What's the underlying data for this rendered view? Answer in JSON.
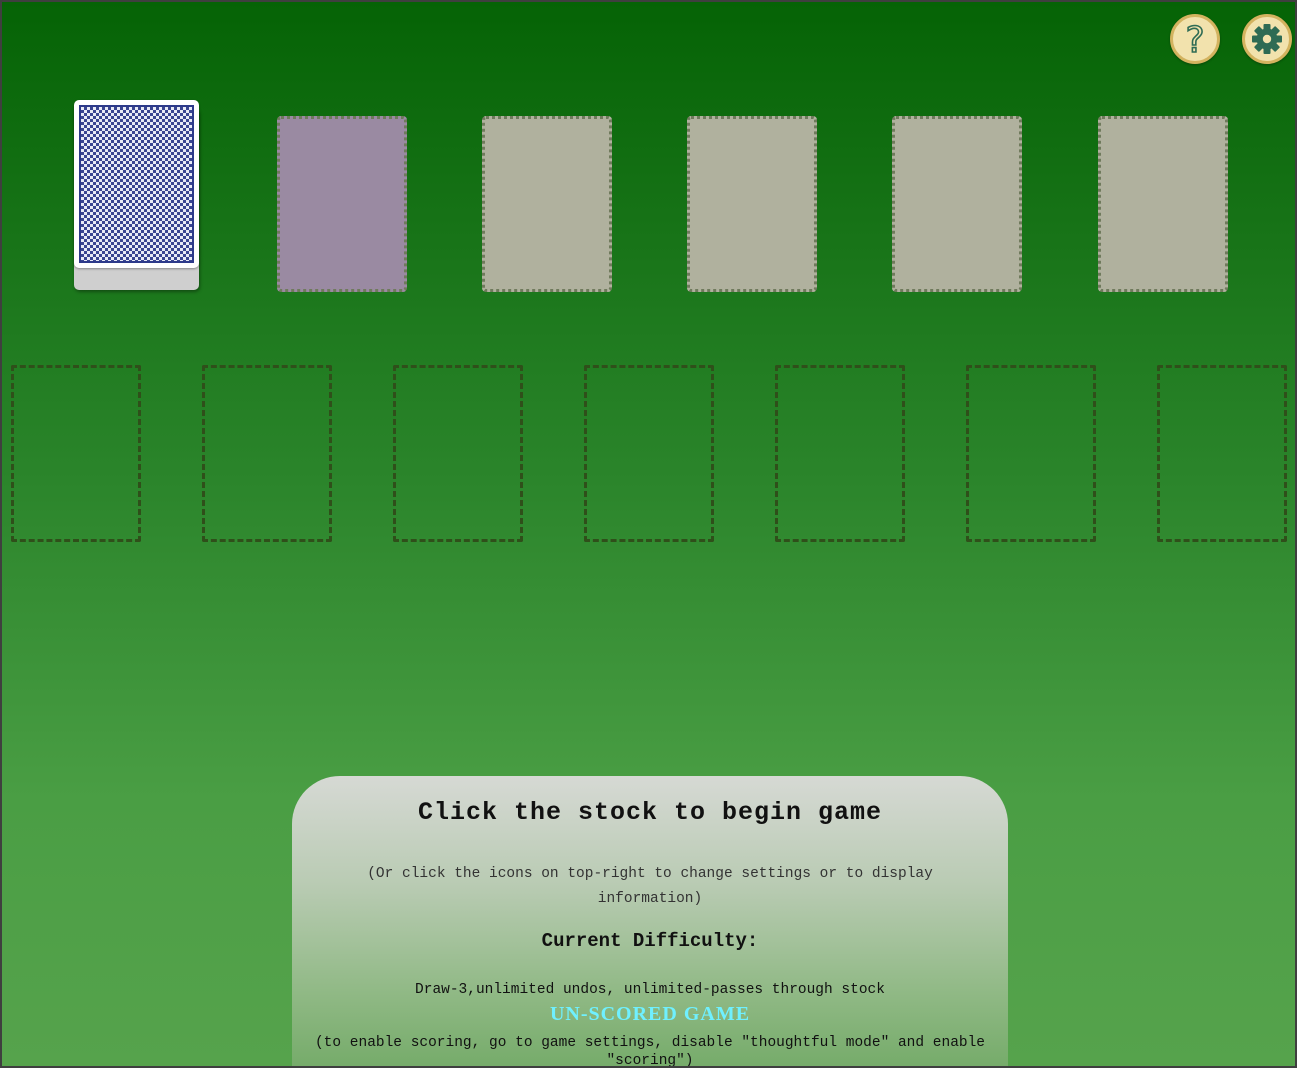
{
  "icons": {
    "help": "question-mark-icon",
    "settings": "gear-icon"
  },
  "colors": {
    "table_top": "#056305",
    "table_bottom": "#56a34c",
    "waste_slot": "#9a8aa2",
    "foundation_slot": "#b0b19e",
    "button_fill": "#f2e2ad",
    "button_ring": "#d3b35f",
    "icon_color": "#2e6b54",
    "unscored": "#6ff0ff"
  },
  "foundations": [
    {
      "name": "foundation-1"
    },
    {
      "name": "foundation-2"
    },
    {
      "name": "foundation-3"
    },
    {
      "name": "foundation-4"
    }
  ],
  "tableau_count": 7,
  "info": {
    "title": "Click the stock to begin game",
    "subtitle": "(Or click the icons on top-right to change settings or to display information)",
    "difficulty_heading": "Current Difficulty:",
    "difficulty": "Draw-3,unlimited undos, unlimited-passes through stock",
    "unscored": "UN-SCORED GAME",
    "hint": "(to enable scoring, go to game settings, disable \"thoughtful mode\" and enable \"scoring\")"
  }
}
